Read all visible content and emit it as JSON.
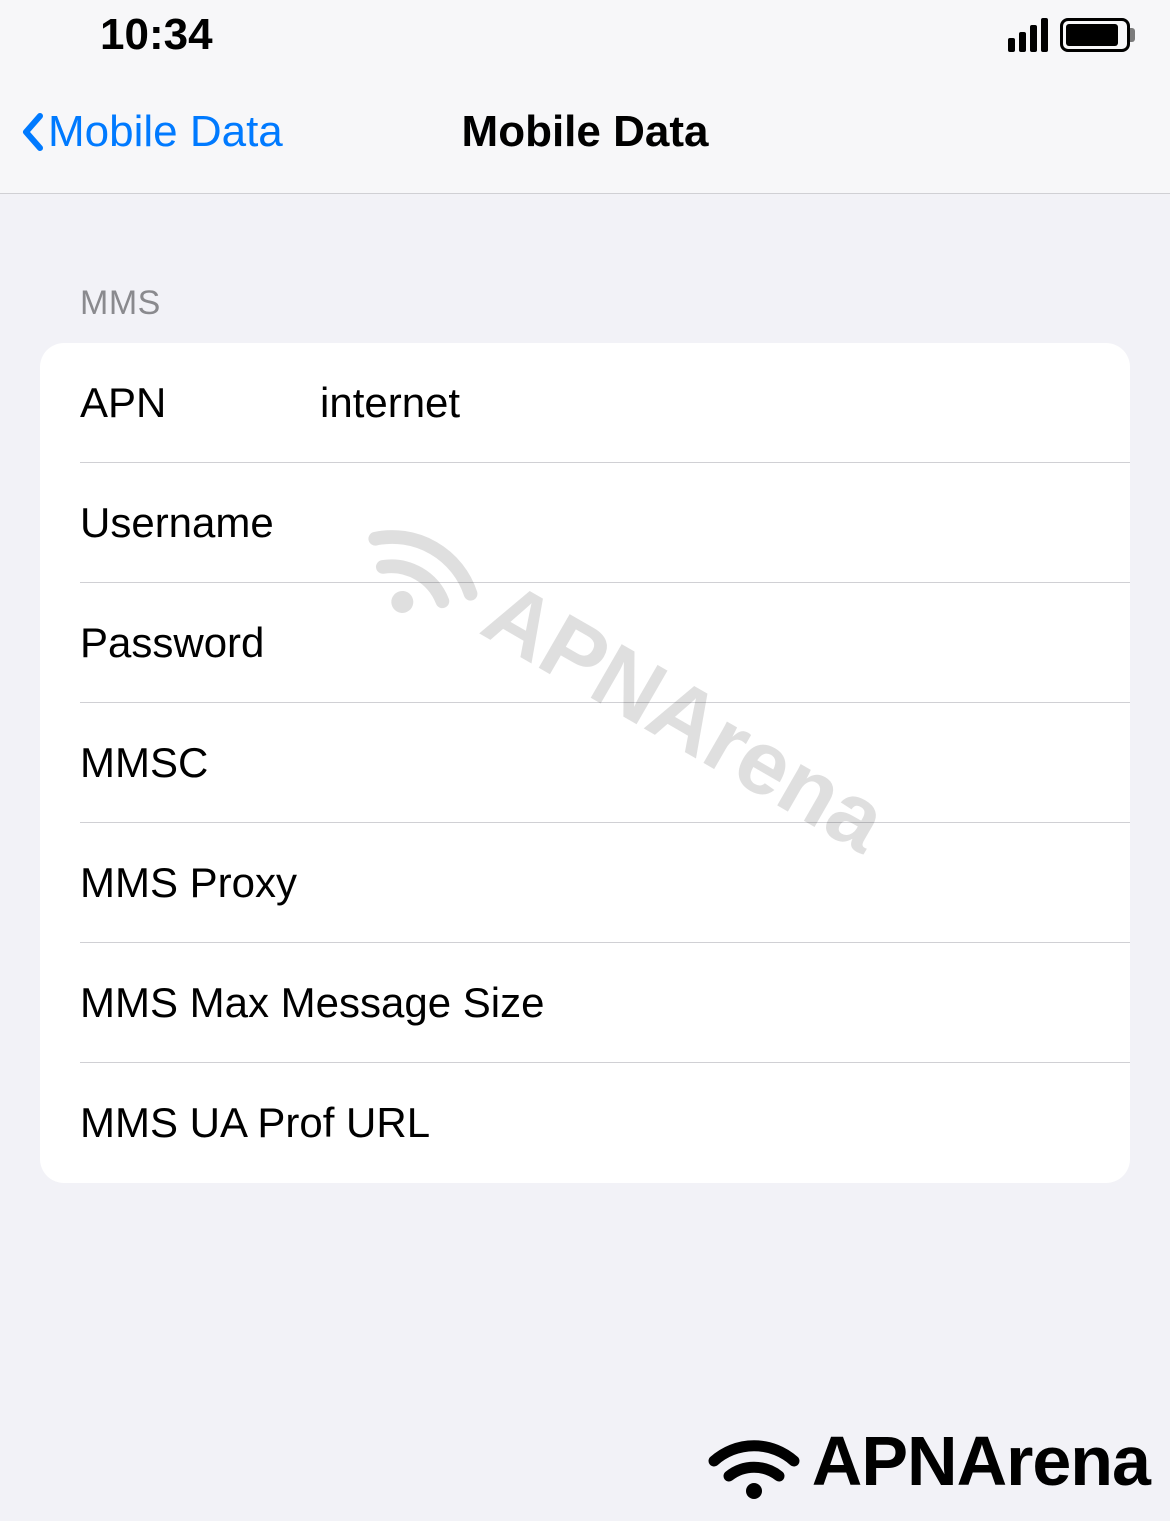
{
  "statusBar": {
    "time": "10:34"
  },
  "nav": {
    "backLabel": "Mobile Data",
    "title": "Mobile Data"
  },
  "section": {
    "header": "MMS",
    "rows": [
      {
        "label": "APN",
        "value": "internet"
      },
      {
        "label": "Username",
        "value": ""
      },
      {
        "label": "Password",
        "value": ""
      },
      {
        "label": "MMSC",
        "value": ""
      },
      {
        "label": "MMS Proxy",
        "value": ""
      },
      {
        "label": "MMS Max Message Size",
        "value": ""
      },
      {
        "label": "MMS UA Prof URL",
        "value": ""
      }
    ]
  },
  "watermark": {
    "text": "APNArena"
  }
}
